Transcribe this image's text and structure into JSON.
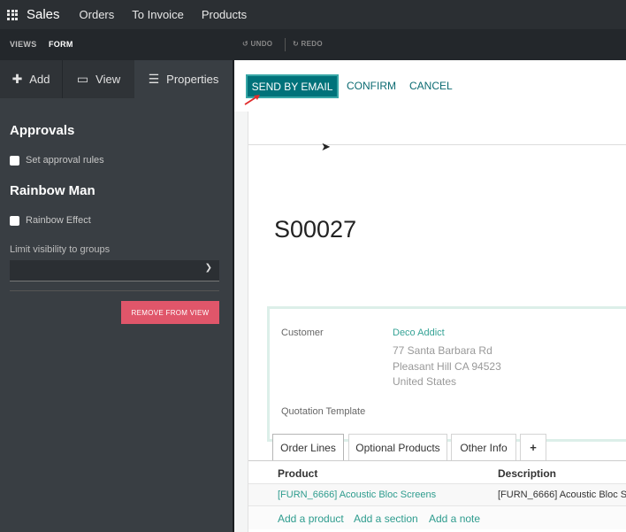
{
  "topbar": {
    "app_name": "Sales",
    "menu": [
      "Orders",
      "To Invoice",
      "Products"
    ]
  },
  "subbar": {
    "views": "VIEWS",
    "form": "FORM",
    "undo": "UNDO",
    "redo": "REDO"
  },
  "sidebar": {
    "tabs": [
      {
        "label": "Add",
        "icon": "plus-icon"
      },
      {
        "label": "View",
        "icon": "monitor-icon"
      },
      {
        "label": "Properties",
        "icon": "list-icon"
      }
    ],
    "approvals_title": "Approvals",
    "approval_rules": "Set approval rules",
    "rainbow_title": "Rainbow Man",
    "rainbow_effect": "Rainbow Effect",
    "groups_label": "Limit visibility to groups",
    "remove_button": "REMOVE FROM VIEW"
  },
  "actions": {
    "send_email": "SEND BY EMAIL",
    "confirm": "CONFIRM",
    "cancel": "CANCEL"
  },
  "form": {
    "order_name": "S00027",
    "customer_label": "Customer",
    "customer_name": "Deco Addict",
    "address": [
      "77 Santa Barbara Rd",
      "Pleasant Hill CA 94523",
      "United States"
    ],
    "template_label": "Quotation Template"
  },
  "notebook": {
    "tabs": [
      "Order Lines",
      "Optional Products",
      "Other Info"
    ],
    "add_tab_symbol": "+"
  },
  "order_lines": {
    "headers": [
      "Product",
      "Description"
    ],
    "rows": [
      {
        "product": "[FURN_6666] Acoustic Bloc Screens",
        "description": "[FURN_6666] Acoustic Bloc S"
      }
    ],
    "add_links": [
      "Add a product",
      "Add a section",
      "Add a note"
    ]
  },
  "colors": {
    "primary": "#00727a",
    "link": "#36a396",
    "danger": "#e0566a",
    "topbar": "#2b2f33",
    "sidebar": "#393e43"
  }
}
